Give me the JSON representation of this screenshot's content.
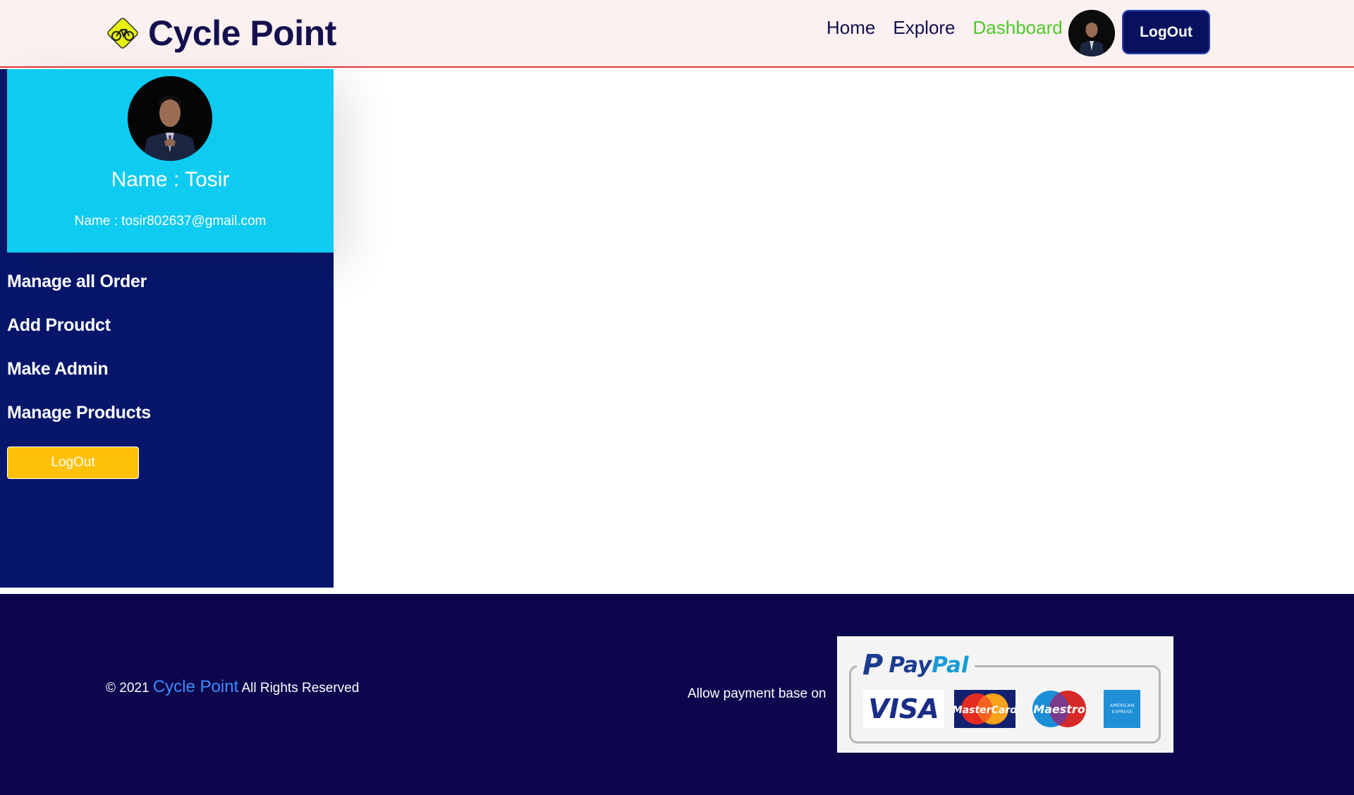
{
  "header": {
    "brand_name": "Cycle Point",
    "logo_icon": "bicycle-sign-icon",
    "nav": [
      {
        "label": "Home",
        "active": false
      },
      {
        "label": "Explore",
        "active": false
      },
      {
        "label": "Dashboard",
        "active": true
      }
    ],
    "logout_label": "LogOut"
  },
  "sidebar": {
    "profile": {
      "name_text": "Name : Tosir",
      "email_text": "Name : tosir802637@gmail.com"
    },
    "menu": [
      {
        "label": "Manage all Order"
      },
      {
        "label": "Add Proudct"
      },
      {
        "label": "Make Admin"
      },
      {
        "label": "Manage Products"
      }
    ],
    "logout_label": "LogOut"
  },
  "footer": {
    "copyright_prefix": "© 2021",
    "copyright_brand": "Cycle Point",
    "copyright_suffix": "All Rights Reserved",
    "payment_label": "Allow payment base on",
    "payment_logos": {
      "paypal_part1": "Pay",
      "paypal_part2": "Pal",
      "visa": "VISA",
      "mastercard": "MasterCard",
      "maestro": "Maestro",
      "amex": "AMERICAN EXPRESS"
    }
  },
  "colors": {
    "header_bg": "#faf1f0",
    "brand_text": "#14104f",
    "nav_active": "#4ec82a",
    "accent_red": "#e53935",
    "logout_btn": "#07115e",
    "profile_card": "#0ecbf1",
    "sidebar_bg": "#07166b",
    "sidebar_logout": "#ffc107",
    "footer_bg": "#0c064d",
    "footer_link": "#3d8bfd"
  }
}
